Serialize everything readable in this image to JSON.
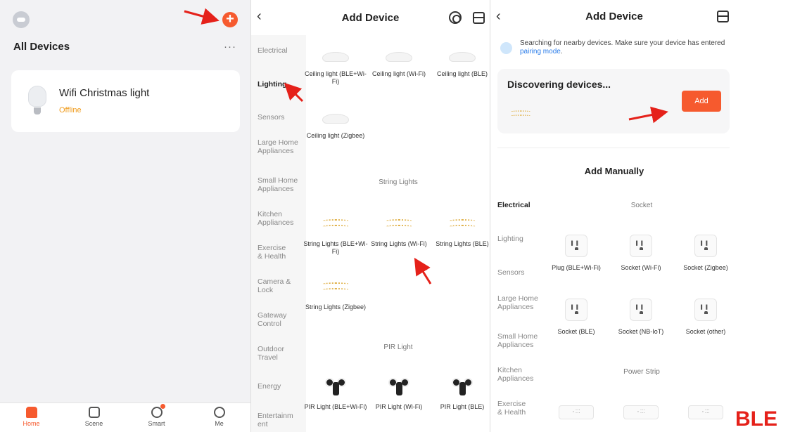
{
  "home": {
    "title": "All Devices",
    "more_glyph": "···",
    "device": {
      "name": "Wifi Christmas light",
      "status": "Offline"
    },
    "nav": [
      {
        "label": "Home"
      },
      {
        "label": "Scene"
      },
      {
        "label": "Smart"
      },
      {
        "label": "Me"
      }
    ]
  },
  "add_device": {
    "title": "Add Device",
    "categories": [
      "Electrical",
      "Lighting",
      "Sensors",
      "Large Home Appliances",
      "Small Home Appliances",
      "Kitchen Appliances",
      "Exercise & Health",
      "Camera & Lock",
      "Gateway Control",
      "Outdoor Travel",
      "Energy",
      "Entertainm ent"
    ],
    "ceiling": [
      "Ceiling light (BLE+Wi-Fi)",
      "Ceiling light (Wi-Fi)",
      "Ceiling light (BLE)",
      "Ceiling light (Zigbee)"
    ],
    "string_section": "String Lights",
    "string": [
      "String Lights (BLE+Wi-Fi)",
      "String Lights (Wi-Fi)",
      "String Lights (BLE)",
      "String Lights (Zigbee)"
    ],
    "pir_section": "PIR Light",
    "pir": [
      "PIR Light (BLE+Wi-Fi)",
      "PIR Light (Wi-Fi)",
      "PIR Light (BLE)"
    ]
  },
  "discover": {
    "title": "Add Device",
    "notice_text": "Searching for nearby devices. Make sure your device has entered",
    "notice_link": "pairing mode",
    "notice_end": ".",
    "discovering": "Discovering devices...",
    "add_button": "Add",
    "manual_title": "Add Manually",
    "categories": [
      "Electrical",
      "Lighting",
      "Sensors",
      "Large Home Appliances",
      "Small Home Appliances",
      "Kitchen Appliances",
      "Exercise & Health"
    ],
    "socket_section": "Socket",
    "sockets": [
      "Plug (BLE+Wi-Fi)",
      "Socket (Wi-Fi)",
      "Socket (Zigbee)",
      "Socket (BLE)",
      "Socket (NB-IoT)",
      "Socket (other)"
    ],
    "strip_section": "Power Strip",
    "strip_glyph": "◦ ⁚⁚⁚"
  },
  "overlay_label": "BLE",
  "colors": {
    "accent": "#f65a2e",
    "link": "#2b7de9",
    "offline": "#ef9a1a",
    "annotation": "#e5211a"
  }
}
